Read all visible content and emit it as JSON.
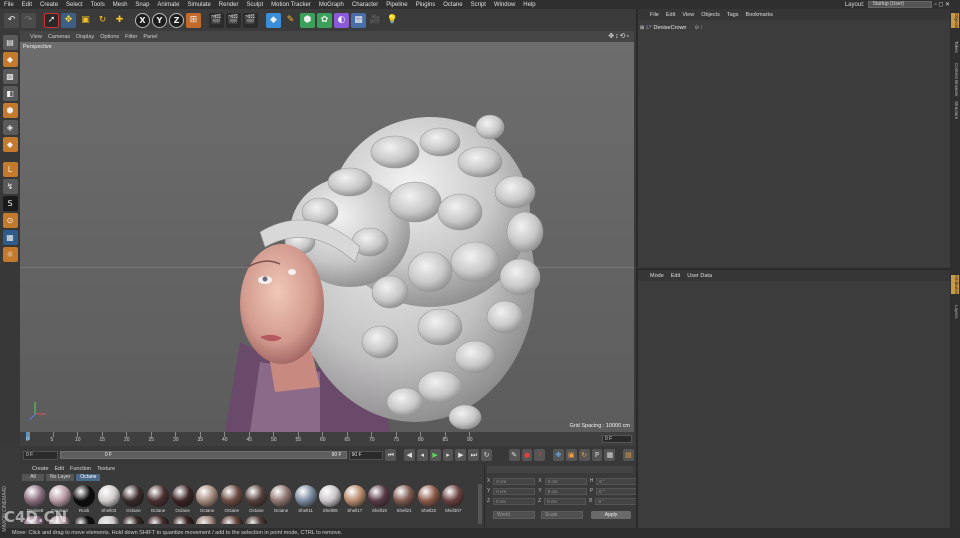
{
  "menubar": {
    "items": [
      "File",
      "Edit",
      "Create",
      "Select",
      "Tools",
      "Mesh",
      "Snap",
      "Animate",
      "Simulate",
      "Render",
      "Sculpt",
      "Motion Tracker",
      "MoGraph",
      "Character",
      "Pipeline",
      "Plugins",
      "Octane",
      "Script",
      "Window",
      "Help"
    ],
    "layout_label": "Layout:",
    "layout_value": "Startup (User)"
  },
  "toolbar": {
    "axis_x": "X",
    "axis_y": "Y",
    "axis_z": "Z"
  },
  "viewport": {
    "menu": [
      "View",
      "Cameras",
      "Display",
      "Options",
      "Filter",
      "Panel"
    ],
    "label": "Perspective",
    "grid_spacing": "Grid Spacing : 10000 cm"
  },
  "timeline": {
    "ticks": [
      "0",
      "5",
      "10",
      "15",
      "20",
      "25",
      "30",
      "35",
      "40",
      "45",
      "50",
      "55",
      "60",
      "65",
      "70",
      "75",
      "80",
      "85",
      "90"
    ],
    "current_frame": "0 F"
  },
  "transport": {
    "start": "0 F",
    "range_start": "0 F",
    "range_end": "90 F",
    "end": "90 F"
  },
  "materials": {
    "menu": [
      "Create",
      "Edit",
      "Function",
      "Texture"
    ],
    "tabs": [
      "All",
      "No Layer",
      "Octane"
    ],
    "items": [
      {
        "label": "Denise8",
        "color": "#8a6e80"
      },
      {
        "label": "Denise4",
        "color": "#b89aa4"
      },
      {
        "label": "Rock",
        "color": "#0c0c0c"
      },
      {
        "label": "Shell03",
        "color": "#d0cbcb"
      },
      {
        "label": "Octane",
        "color": "#3a2a2a"
      },
      {
        "label": "Octane",
        "color": "#4a3030"
      },
      {
        "label": "Octane",
        "color": "#3b2424"
      },
      {
        "label": "Octane",
        "color": "#a58a7e"
      },
      {
        "label": "Octane",
        "color": "#6b4a42"
      },
      {
        "label": "Octane",
        "color": "#54403c"
      },
      {
        "label": "Octane",
        "color": "#8f7770"
      },
      {
        "label": "Shell11",
        "color": "#7a8aa0"
      },
      {
        "label": "Shell08",
        "color": "#c9c5c8"
      },
      {
        "label": "Shell17",
        "color": "#b88a6c"
      },
      {
        "label": "Shell19",
        "color": "#5a3a48"
      },
      {
        "label": "Shell21",
        "color": "#7e5a4e"
      },
      {
        "label": "Shell22",
        "color": "#8c5a4a"
      },
      {
        "label": "Shel307",
        "color": "#6a4040"
      }
    ]
  },
  "coords": {
    "rows": [
      {
        "a": "X",
        "av": "0 cm",
        "b": "X",
        "bv": "0 cm",
        "c": "H",
        "cv": "0 °"
      },
      {
        "a": "Y",
        "av": "0 cm",
        "b": "Y",
        "bv": "0 cm",
        "c": "P",
        "cv": "0 °"
      },
      {
        "a": "Z",
        "av": "0 cm",
        "b": "Z",
        "bv": "0 cm",
        "c": "B",
        "cv": "0 °"
      }
    ],
    "world": "World",
    "scale": "Scale",
    "apply": "Apply"
  },
  "objects": {
    "menu": [
      "File",
      "Edit",
      "View",
      "Objects",
      "Tags",
      "Bookmarks"
    ],
    "items": [
      "DeniseCrown"
    ]
  },
  "attributes": {
    "menu": [
      "Mode",
      "Edit",
      "User Data"
    ]
  },
  "right_tabs": [
    "Objects",
    "Takes",
    "Content Browser",
    "Structure",
    "Attributes",
    "Layers"
  ],
  "status": "Move: Click and drag to move elements. Hold down SHIFT to quantize movement / add to the selection in point mode, CTRL to remove.",
  "watermark": "C4D.CN",
  "vendor_logo": "MAXON CINEMA4D"
}
